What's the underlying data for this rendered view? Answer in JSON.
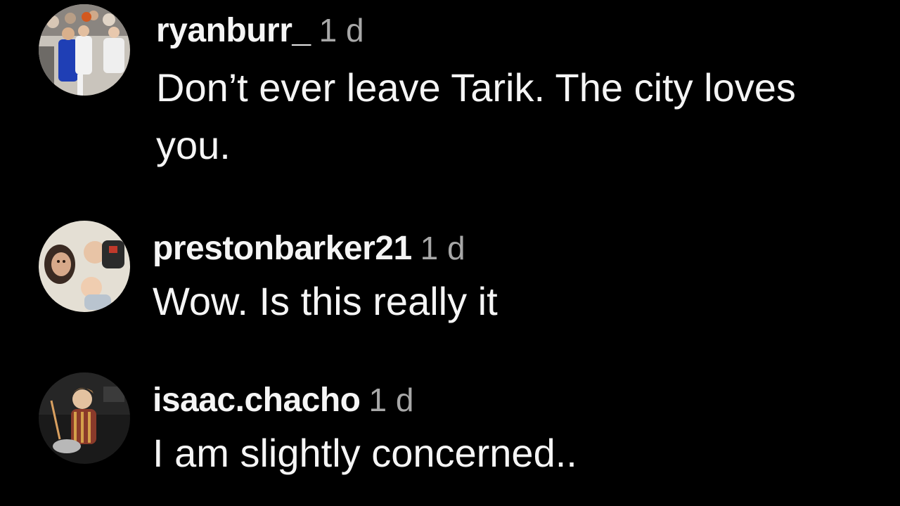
{
  "comments": [
    {
      "username": "ryanburr_",
      "timestamp": "1 d",
      "text": "Don’t ever leave Tarik. The city loves you.",
      "avatar": "basketball-game-photo"
    },
    {
      "username": "prestonbarker21",
      "timestamp": "1 d",
      "text": "Wow. Is this really it",
      "avatar": "children-lying-down-photo"
    },
    {
      "username": "isaac.chacho",
      "timestamp": "1 d",
      "text": "I am slightly concerned..",
      "avatar": "drummer-photo"
    }
  ],
  "colors": {
    "background": "#000000",
    "primary_text": "#f5f5f5",
    "secondary_text": "#a8a8a8"
  }
}
